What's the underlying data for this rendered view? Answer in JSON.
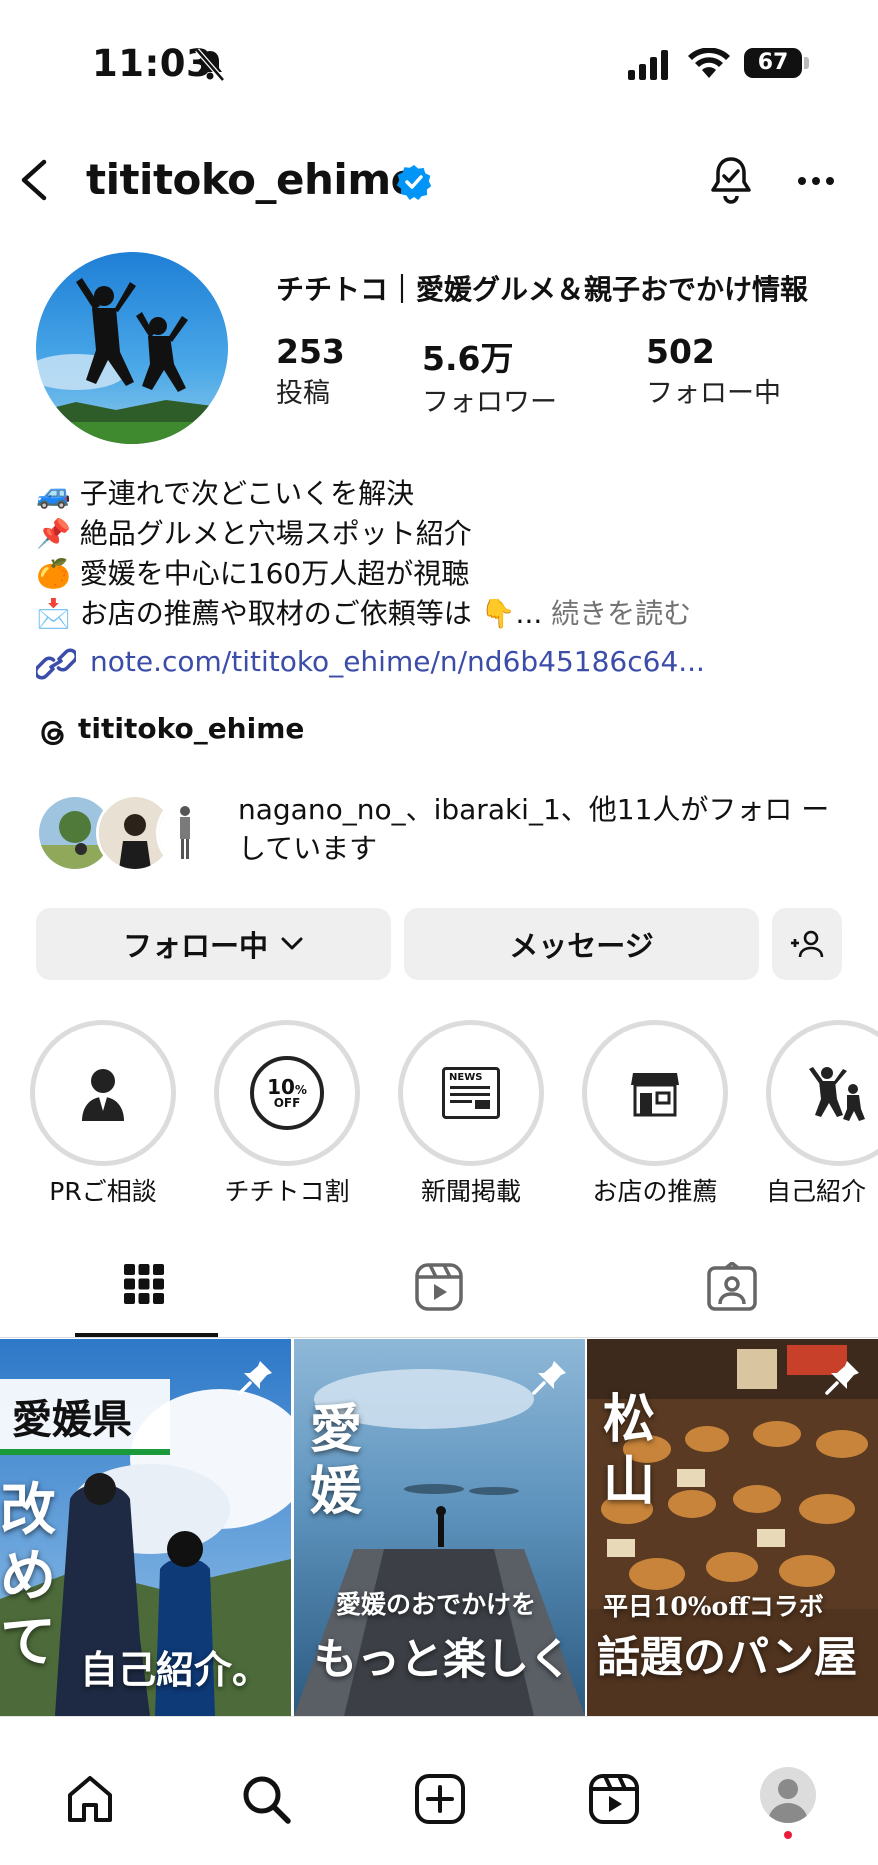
{
  "status_bar": {
    "time": "11:03",
    "battery": "67"
  },
  "header": {
    "username": "tititoko_ehime"
  },
  "profile": {
    "display_name": "チチトコ｜愛媛グルメ＆親子おでかけ情報",
    "stats": [
      {
        "value": "253",
        "label": "投稿"
      },
      {
        "value": "5.6万",
        "label": "フォロワー"
      },
      {
        "value": "502",
        "label": "フォロー中"
      }
    ],
    "bio": [
      {
        "emoji": "🚙",
        "text": "子連れで次どこいくを解決"
      },
      {
        "emoji": "📌",
        "text": "絶品グルメと穴場スポット紹介"
      },
      {
        "emoji": "🍊",
        "text": "愛媛を中心に160万人超が視聴"
      },
      {
        "emoji": "📩",
        "text": "お店の推薦や取材のご依頼等は 👇...",
        "more": "続きを読む"
      }
    ],
    "link": "note.com/tititoko_ehime/n/nd6b45186c64...",
    "threads_handle": "tititoko_ehime",
    "followed_by": "nagano_no_、ibaraki_1、他11人がフォロ ーしています"
  },
  "buttons": {
    "following": "フォロー中",
    "message": "メッセージ"
  },
  "highlights": [
    {
      "label": "PRご相談",
      "icon": "person-suit-icon"
    },
    {
      "label": "チチトコ割",
      "icon": "discount-sticker-icon",
      "badge_top": "10",
      "badge_pct": "%",
      "badge_bottom": "OFF"
    },
    {
      "label": "新聞掲載",
      "icon": "newspaper-icon",
      "badge": "NEWS"
    },
    {
      "label": "お店の推薦",
      "icon": "storefront-icon"
    },
    {
      "label": "自己紹介",
      "icon": "jumping-people-icon"
    }
  ],
  "posts": [
    {
      "tag": "愛媛県",
      "vertical": "改めて",
      "caption": "自己紹介。",
      "pinned": true
    },
    {
      "vertical": "愛媛",
      "sub": "愛媛のおでかけを",
      "caption": "もっと楽しく",
      "pinned": true
    },
    {
      "vertical": "松山",
      "sub": "平日10%offコラボ",
      "caption": "話題のパン屋",
      "pinned": true
    }
  ],
  "colors": {
    "accent": "#0095f6",
    "link": "#3b4da8",
    "button_bg": "#efefef",
    "notification_dot": "#ed1c3c"
  }
}
